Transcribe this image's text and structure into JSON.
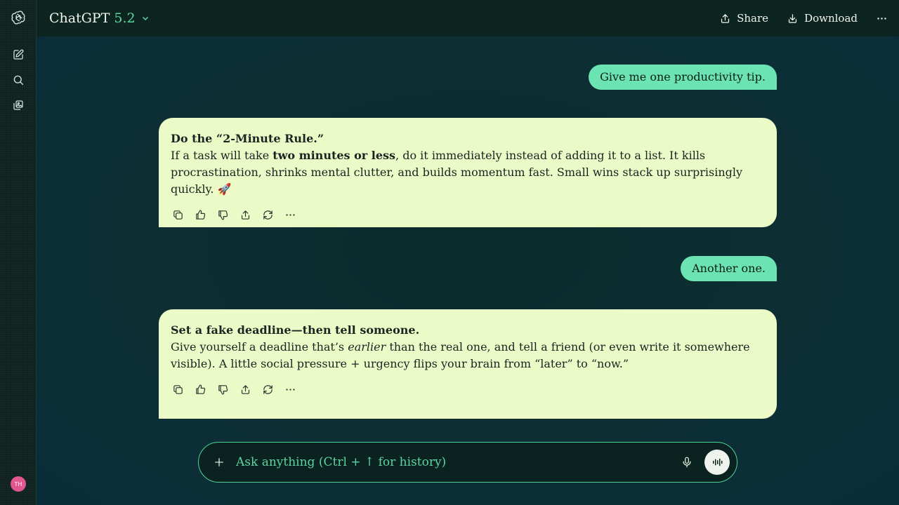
{
  "header": {
    "app_name": "ChatGPT",
    "model_version": "5.2",
    "share_label": "Share",
    "download_label": "Download"
  },
  "sidebar": {
    "icons": [
      "openai-logo-icon",
      "new-chat-icon",
      "search-icon",
      "library-icon"
    ],
    "avatar_initials": "TH"
  },
  "conversation": {
    "messages": [
      {
        "role": "user",
        "text": "Give me one productivity tip."
      },
      {
        "role": "assistant",
        "heading": "Do the “2-Minute Rule.”",
        "body_before": "If a task will take ",
        "body_bold": "two minutes or less",
        "body_after": ", do it immediately instead of adding it to a list. It kills procrastination, shrinks mental clutter, and builds momentum fast. Small wins stack up surprisingly quickly. 🚀"
      },
      {
        "role": "user",
        "text": "Another one."
      },
      {
        "role": "assistant",
        "heading": "Set a fake deadline—then tell someone.",
        "body_before": "Give yourself a deadline that’s ",
        "body_italic": "earlier",
        "body_after": " than the real one, and tell a friend (or even write it somewhere visible). A little social pressure + urgency flips your brain from “later” to “now.”"
      }
    ]
  },
  "composer": {
    "placeholder": "Ask anything (Ctrl + ↑ for history)"
  },
  "colors": {
    "accent": "#5fd4a0",
    "user_bubble": "#6be3b2",
    "assistant_bubble": "#ecfac8",
    "avatar": "#e2558f"
  }
}
